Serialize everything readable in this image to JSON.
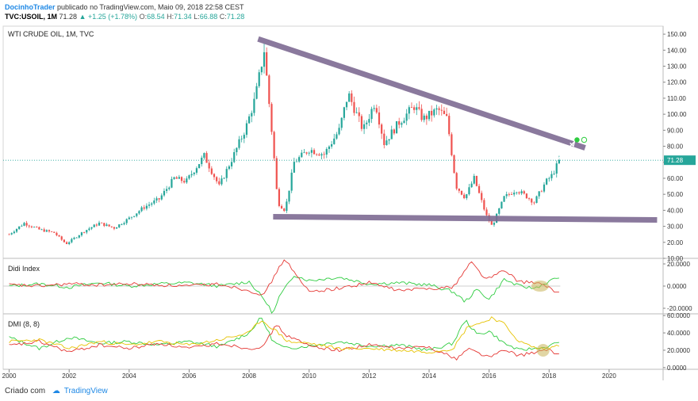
{
  "header": {
    "author": "DocinhoTrader",
    "published_text": "publicado no TradingView.com, Maio 09, 2018 22:58 CEST",
    "symbol": "TVC:USOIL, 1M",
    "last": "71.28",
    "change": "+1.25 (+1.78%)",
    "ohlc": {
      "o_label": "O:",
      "o": "68.54",
      "h_label": "H:",
      "h": "71.34",
      "l_label": "L:",
      "l": "66.88",
      "c_label": "C:",
      "c": "71.28"
    }
  },
  "footer": {
    "created_with": "Criado com",
    "brand": "TradingView"
  },
  "colors": {
    "up": "#26a69a",
    "down": "#ef5350",
    "trendline": "#7e6b93",
    "didi_green": "#2ecc40",
    "didi_red": "#e53935",
    "dmi_yellow": "#e6c200",
    "highlight": "#c8b45a"
  },
  "chart_data": [
    {
      "type": "candlestick",
      "pane": "price",
      "title": "WTI CRUDE OIL, 1M, TVC",
      "ylim": [
        10,
        155
      ],
      "yticks": [
        "150.00",
        "140.00",
        "130.00",
        "120.00",
        "110.00",
        "100.00",
        "90.00",
        "80.00",
        "70.00",
        "60.00",
        "50.00",
        "40.00",
        "30.00",
        "20.00",
        "10.00"
      ],
      "last_price_label": "71.28",
      "x_ticks": [
        "2000",
        "2002",
        "2004",
        "2006",
        "2008",
        "2010",
        "2012",
        "2014",
        "2016",
        "2018",
        "2020"
      ],
      "approx_monthly_close_path": [
        [
          2000.0,
          25
        ],
        [
          2000.5,
          32
        ],
        [
          2001.0,
          28
        ],
        [
          2001.5,
          26
        ],
        [
          2001.9,
          19
        ],
        [
          2002.5,
          27
        ],
        [
          2003.0,
          32
        ],
        [
          2003.5,
          29
        ],
        [
          2004.0,
          35
        ],
        [
          2004.5,
          42
        ],
        [
          2005.0,
          47
        ],
        [
          2005.5,
          60
        ],
        [
          2005.9,
          58
        ],
        [
          2006.5,
          74
        ],
        [
          2007.0,
          55
        ],
        [
          2007.5,
          75
        ],
        [
          2007.9,
          92
        ],
        [
          2008.2,
          110
        ],
        [
          2008.5,
          140
        ],
        [
          2008.8,
          80
        ],
        [
          2008.95,
          45
        ],
        [
          2009.2,
          40
        ],
        [
          2009.5,
          70
        ],
        [
          2010.0,
          78
        ],
        [
          2010.5,
          75
        ],
        [
          2011.0,
          90
        ],
        [
          2011.3,
          113
        ],
        [
          2011.8,
          90
        ],
        [
          2012.2,
          108
        ],
        [
          2012.5,
          82
        ],
        [
          2013.0,
          95
        ],
        [
          2013.5,
          105
        ],
        [
          2013.8,
          97
        ],
        [
          2014.3,
          103
        ],
        [
          2014.6,
          97
        ],
        [
          2014.9,
          55
        ],
        [
          2015.2,
          48
        ],
        [
          2015.5,
          60
        ],
        [
          2015.9,
          37
        ],
        [
          2016.1,
          30
        ],
        [
          2016.5,
          48
        ],
        [
          2016.9,
          53
        ],
        [
          2017.3,
          48
        ],
        [
          2017.5,
          45
        ],
        [
          2017.9,
          58
        ],
        [
          2018.1,
          62
        ],
        [
          2018.35,
          71.28
        ]
      ],
      "annotations": [
        {
          "type": "trendline",
          "from": [
            2008.3,
            147
          ],
          "to": [
            2019.2,
            79
          ]
        },
        {
          "type": "trendline",
          "from": [
            2008.8,
            36
          ],
          "to": [
            2021.6,
            34
          ]
        },
        {
          "type": "arrow",
          "from": [
            2018.3,
            72
          ],
          "to": [
            2018.85,
            83
          ]
        }
      ]
    },
    {
      "type": "line",
      "pane": "indicator",
      "title": "Didi Index",
      "ylim": [
        -25,
        25
      ],
      "yticks": [
        "20.0000",
        "0.0000",
        "-20.0000"
      ],
      "series": [
        {
          "values": [
            [
              2000,
              0
            ],
            [
              2001,
              2
            ],
            [
              2002,
              -1
            ],
            [
              2003,
              3
            ],
            [
              2004,
              0
            ],
            [
              2005,
              2
            ],
            [
              2006,
              3
            ],
            [
              2007,
              0
            ],
            [
              2008.0,
              4
            ],
            [
              2008.5,
              -12
            ],
            [
              2008.8,
              -25
            ],
            [
              2009.0,
              -10
            ],
            [
              2009.5,
              10
            ],
            [
              2010,
              5
            ],
            [
              2011,
              8
            ],
            [
              2012,
              2
            ],
            [
              2013,
              3
            ],
            [
              2014,
              1
            ],
            [
              2014.8,
              -5
            ],
            [
              2015.2,
              -14
            ],
            [
              2015.6,
              -3
            ],
            [
              2016,
              -12
            ],
            [
              2016.5,
              6
            ],
            [
              2017,
              0
            ],
            [
              2017.5,
              -2
            ],
            [
              2018,
              4
            ],
            [
              2018.3,
              8
            ]
          ]
        },
        {
          "values": [
            [
              2000,
              1
            ],
            [
              2001,
              0
            ],
            [
              2002,
              2
            ],
            [
              2003,
              1
            ],
            [
              2004,
              2
            ],
            [
              2005,
              1
            ],
            [
              2006,
              0
            ],
            [
              2007,
              2
            ],
            [
              2008.0,
              -4
            ],
            [
              2008.5,
              -8
            ],
            [
              2008.9,
              12
            ],
            [
              2009.2,
              25
            ],
            [
              2009.6,
              8
            ],
            [
              2010,
              -5
            ],
            [
              2011,
              -2
            ],
            [
              2012,
              3
            ],
            [
              2013,
              -4
            ],
            [
              2014,
              -2
            ],
            [
              2014.8,
              -1
            ],
            [
              2015.4,
              22
            ],
            [
              2015.9,
              6
            ],
            [
              2016.5,
              14
            ],
            [
              2017,
              4
            ],
            [
              2017.6,
              3
            ],
            [
              2018,
              -2
            ],
            [
              2018.3,
              -6
            ]
          ]
        }
      ]
    },
    {
      "type": "line",
      "pane": "indicator",
      "title": "DMI (8, 8)",
      "ylim": [
        -2,
        62
      ],
      "yticks": [
        "60.0000",
        "40.0000",
        "20.0000",
        "0.0000"
      ],
      "series": [
        {
          "values": [
            [
              2000,
              35
            ],
            [
              2001,
              22
            ],
            [
              2002,
              35
            ],
            [
              2003,
              28
            ],
            [
              2004,
              30
            ],
            [
              2005,
              26
            ],
            [
              2006,
              30
            ],
            [
              2007,
              24
            ],
            [
              2008.0,
              40
            ],
            [
              2008.4,
              58
            ],
            [
              2008.8,
              30
            ],
            [
              2009.2,
              22
            ],
            [
              2010,
              25
            ],
            [
              2011,
              30
            ],
            [
              2012,
              25
            ],
            [
              2013,
              26
            ],
            [
              2014,
              20
            ],
            [
              2014.8,
              28
            ],
            [
              2015.2,
              55
            ],
            [
              2015.6,
              38
            ],
            [
              2016,
              42
            ],
            [
              2016.5,
              28
            ],
            [
              2017,
              20
            ],
            [
              2017.5,
              22
            ],
            [
              2018,
              24
            ],
            [
              2018.3,
              30
            ]
          ]
        },
        {
          "values": [
            [
              2000,
              25
            ],
            [
              2001,
              30
            ],
            [
              2002,
              18
            ],
            [
              2003,
              26
            ],
            [
              2004,
              22
            ],
            [
              2005,
              28
            ],
            [
              2006,
              22
            ],
            [
              2007,
              28
            ],
            [
              2008.0,
              22
            ],
            [
              2008.5,
              25
            ],
            [
              2008.9,
              50
            ],
            [
              2009.2,
              38
            ],
            [
              2010,
              25
            ],
            [
              2011,
              20
            ],
            [
              2012,
              26
            ],
            [
              2013,
              22
            ],
            [
              2014,
              24
            ],
            [
              2014.9,
              10
            ],
            [
              2015.3,
              22
            ],
            [
              2016,
              12
            ],
            [
              2016.5,
              20
            ],
            [
              2017,
              14
            ],
            [
              2017.6,
              18
            ],
            [
              2018,
              20
            ],
            [
              2018.3,
              15
            ]
          ]
        },
        {
          "values": [
            [
              2000,
              30
            ],
            [
              2001,
              32
            ],
            [
              2002,
              22
            ],
            [
              2003,
              30
            ],
            [
              2004,
              26
            ],
            [
              2005,
              30
            ],
            [
              2006,
              26
            ],
            [
              2007,
              32
            ],
            [
              2008.0,
              40
            ],
            [
              2008.4,
              55
            ],
            [
              2008.9,
              42
            ],
            [
              2009.3,
              30
            ],
            [
              2010,
              28
            ],
            [
              2011,
              22
            ],
            [
              2012,
              22
            ],
            [
              2013,
              20
            ],
            [
              2014,
              18
            ],
            [
              2014.8,
              22
            ],
            [
              2015.3,
              48
            ],
            [
              2015.8,
              52
            ],
            [
              2016.1,
              58
            ],
            [
              2016.5,
              50
            ],
            [
              2017,
              30
            ],
            [
              2017.6,
              22
            ],
            [
              2018,
              22
            ],
            [
              2018.3,
              26
            ]
          ]
        }
      ]
    }
  ]
}
